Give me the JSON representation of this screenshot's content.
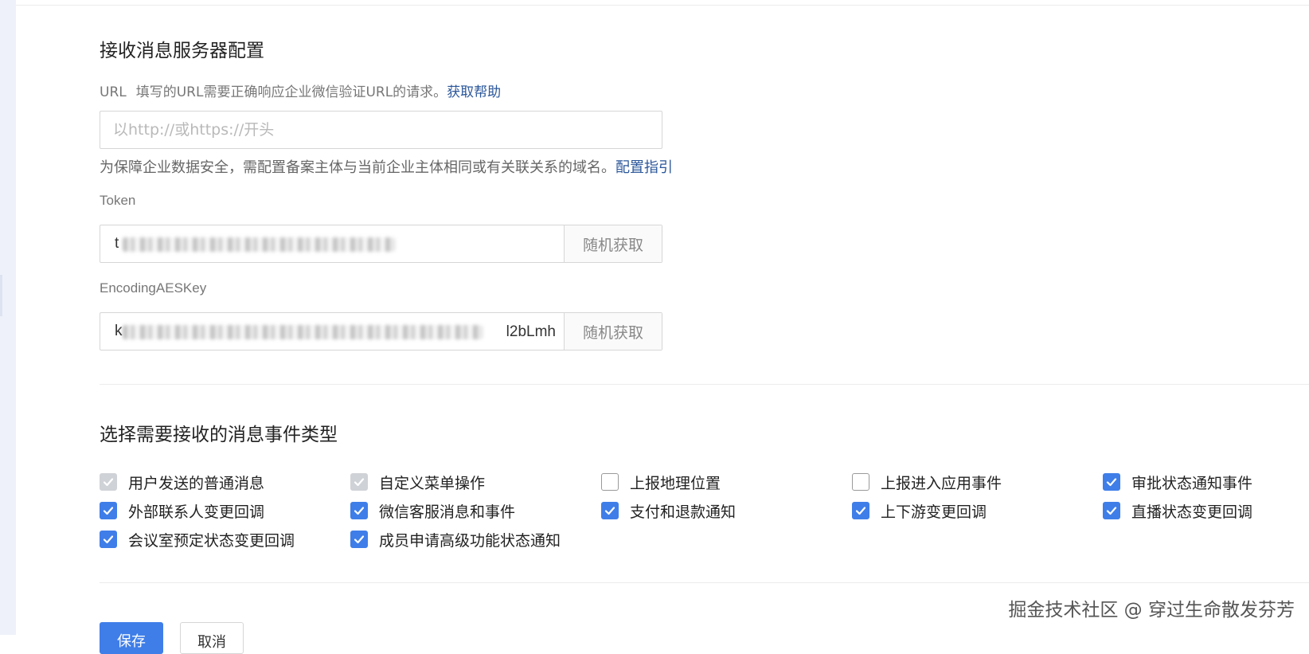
{
  "server_config": {
    "title": "接收消息服务器配置",
    "url": {
      "label": "URL",
      "hint": "填写的URL需要正确响应企业微信验证URL的请求。",
      "help_link": "获取帮助",
      "placeholder": "以http://或https://开头",
      "value": "",
      "note": "为保障企业数据安全，需配置备案主体与当前企业主体相同或有关联关系的域名。",
      "guide_link": "配置指引"
    },
    "token": {
      "label": "Token",
      "value_visible": "t",
      "random_button": "随机获取"
    },
    "aes_key": {
      "label": "EncodingAESKey",
      "value_visible_start": "k",
      "value_visible_end": "l2bLmh",
      "random_button": "随机获取"
    }
  },
  "events": {
    "title": "选择需要接收的消息事件类型",
    "items": [
      {
        "label": "用户发送的普通消息",
        "state": "disabled"
      },
      {
        "label": "自定义菜单操作",
        "state": "disabled"
      },
      {
        "label": "上报地理位置",
        "state": "unchecked"
      },
      {
        "label": "上报进入应用事件",
        "state": "unchecked"
      },
      {
        "label": "审批状态通知事件",
        "state": "checked"
      },
      {
        "label": "外部联系人变更回调",
        "state": "checked"
      },
      {
        "label": "微信客服消息和事件",
        "state": "checked"
      },
      {
        "label": "支付和退款通知",
        "state": "checked"
      },
      {
        "label": "上下游变更回调",
        "state": "checked"
      },
      {
        "label": "直播状态变更回调",
        "state": "checked"
      },
      {
        "label": "会议室预定状态变更回调",
        "state": "checked"
      },
      {
        "label": "成员申请高级功能状态通知",
        "state": "checked"
      }
    ]
  },
  "actions": {
    "save_label": "保存",
    "cancel_label": "取消"
  },
  "watermark": "掘金技术社区 @ 穿过生命散发芬芳",
  "colors": {
    "accent": "#3f7ee8",
    "link": "#2b579a",
    "disabled_check": "#cfd2d6",
    "sidebar_bg": "#eef1f9"
  }
}
